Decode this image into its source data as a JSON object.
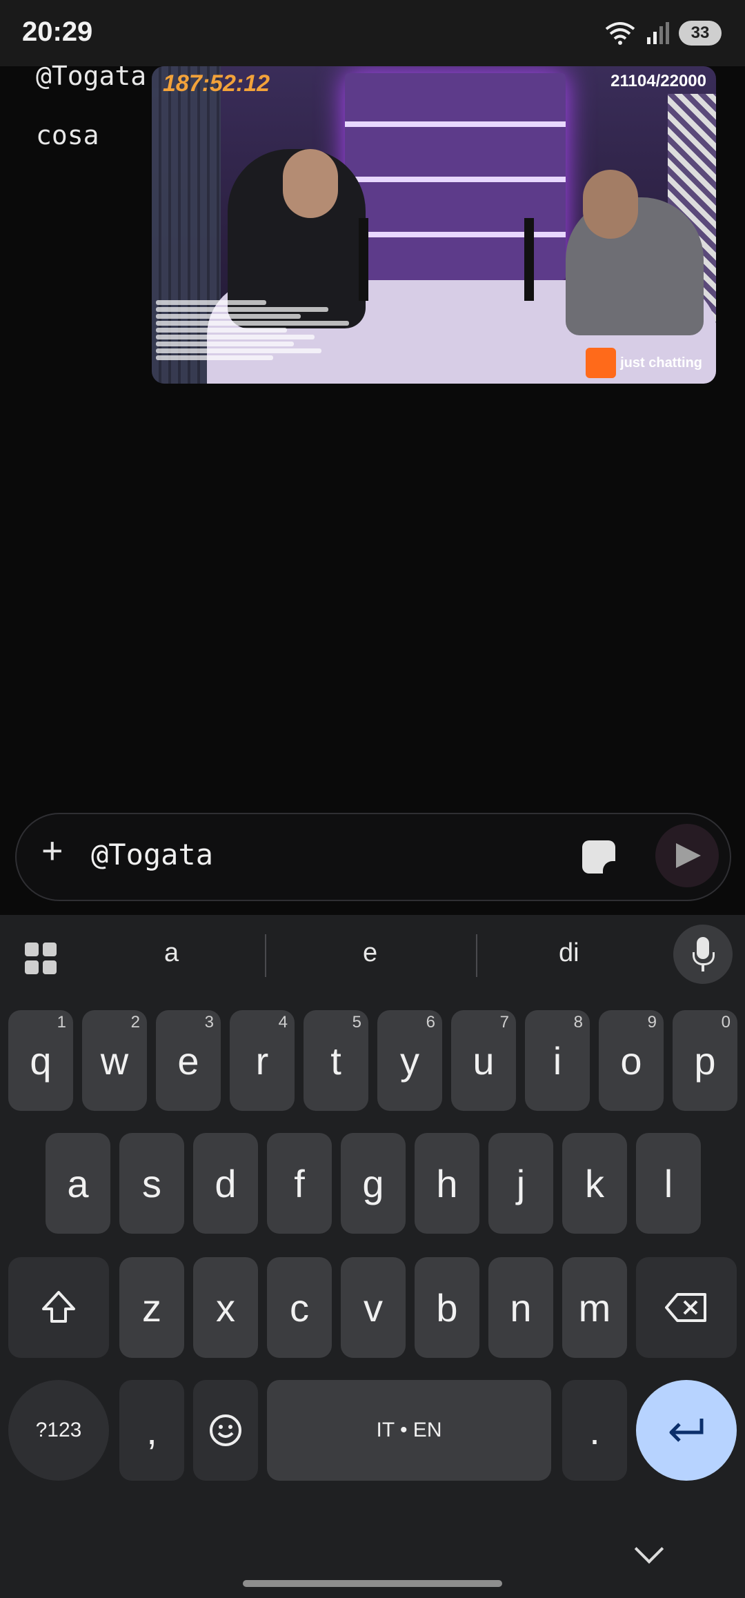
{
  "status_bar": {
    "time": "20:29",
    "battery": "33"
  },
  "chat": {
    "messages": [
      {
        "text": "@Togata"
      },
      {
        "text": "cosa"
      }
    ],
    "video_overlay": {
      "timer": "187:52:12",
      "counter": "21104/22000",
      "badge": "just chatting"
    }
  },
  "composer": {
    "plus_label": "+",
    "input_value": "@Togata"
  },
  "keyboard": {
    "suggestions": [
      "a",
      "e",
      "di"
    ],
    "row1": [
      {
        "key": "q",
        "num": "1"
      },
      {
        "key": "w",
        "num": "2"
      },
      {
        "key": "e",
        "num": "3"
      },
      {
        "key": "r",
        "num": "4"
      },
      {
        "key": "t",
        "num": "5"
      },
      {
        "key": "y",
        "num": "6"
      },
      {
        "key": "u",
        "num": "7"
      },
      {
        "key": "i",
        "num": "8"
      },
      {
        "key": "o",
        "num": "9"
      },
      {
        "key": "p",
        "num": "0"
      }
    ],
    "row2": [
      "a",
      "s",
      "d",
      "f",
      "g",
      "h",
      "j",
      "k",
      "l"
    ],
    "row3": [
      "z",
      "x",
      "c",
      "v",
      "b",
      "n",
      "m"
    ],
    "symbols_key": "?123",
    "comma_key": ",",
    "space_key": "IT • EN",
    "period_key": "."
  },
  "colors": {
    "enter_key": "#b7d3ff",
    "timer": "#f2a23a",
    "badge": "#ff6a1a"
  }
}
